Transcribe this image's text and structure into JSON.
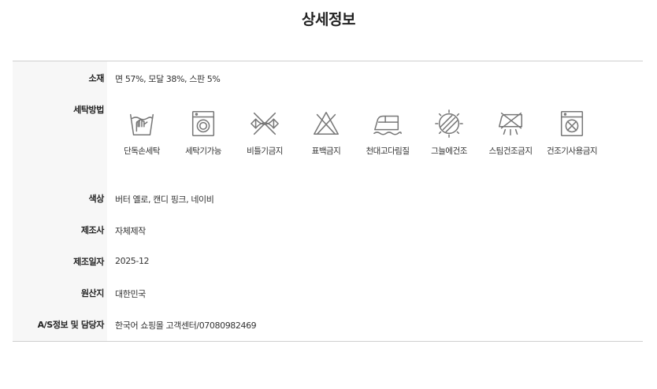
{
  "page": {
    "title": "상세정보"
  },
  "rows": {
    "material": {
      "label": "소재",
      "value": "면 57%, 모달 38%, 스판 5%"
    },
    "washing": {
      "label": "세탁방법"
    },
    "color": {
      "label": "색상",
      "value": "버터 옐로, 캔디 핑크, 네이비"
    },
    "manufacturer": {
      "label": "제조사",
      "value": "자체제작"
    },
    "manufacture_date": {
      "label": "제조일자",
      "value": "2025-12"
    },
    "origin": {
      "label": "원산지",
      "value": "대한민국"
    },
    "as_contact": {
      "label": "A/S정보 및 담당자",
      "value": "한국어 쇼핑몰 고객센터/07080982469"
    }
  },
  "care_instructions": [
    {
      "icon": "hand-wash-icon",
      "label": "단독손세탁"
    },
    {
      "icon": "washing-machine-icon",
      "label": "세탁기가능"
    },
    {
      "icon": "no-wring-icon",
      "label": "비틀기금지"
    },
    {
      "icon": "no-bleach-icon",
      "label": "표백금지"
    },
    {
      "icon": "iron-with-cloth-icon",
      "label": "천대고다림질"
    },
    {
      "icon": "shade-dry-icon",
      "label": "그늘에건조"
    },
    {
      "icon": "no-steam-dry-icon",
      "label": "스팀건조금지"
    },
    {
      "icon": "no-tumble-dry-icon",
      "label": "건조기사용금지"
    }
  ]
}
